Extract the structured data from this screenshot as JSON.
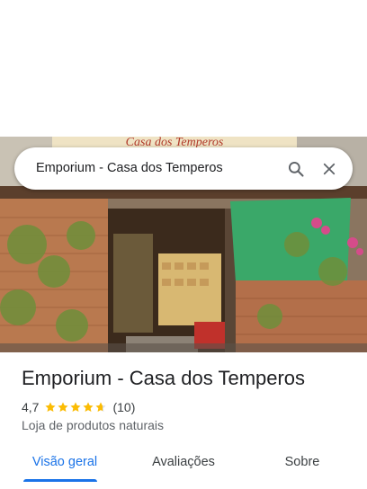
{
  "search": {
    "query": "Emporium - Casa dos Temperos"
  },
  "storefront": {
    "sign_text": "Casa dos Temperos"
  },
  "place": {
    "name": "Emporium - Casa dos Temperos",
    "rating": "4,7",
    "rating_value": 4.7,
    "review_count": "(10)",
    "category": "Loja de produtos naturais"
  },
  "tabs": [
    {
      "label": "Visão geral",
      "active": true
    },
    {
      "label": "Avaliações",
      "active": false
    },
    {
      "label": "Sobre",
      "active": false
    }
  ],
  "colors": {
    "accent": "#1a73e8",
    "star": "#fbbc04",
    "text": "#202124",
    "secondary_text": "#5f6368"
  },
  "icons": {
    "search": "search-icon",
    "close": "close-icon",
    "star": "star-icon"
  }
}
